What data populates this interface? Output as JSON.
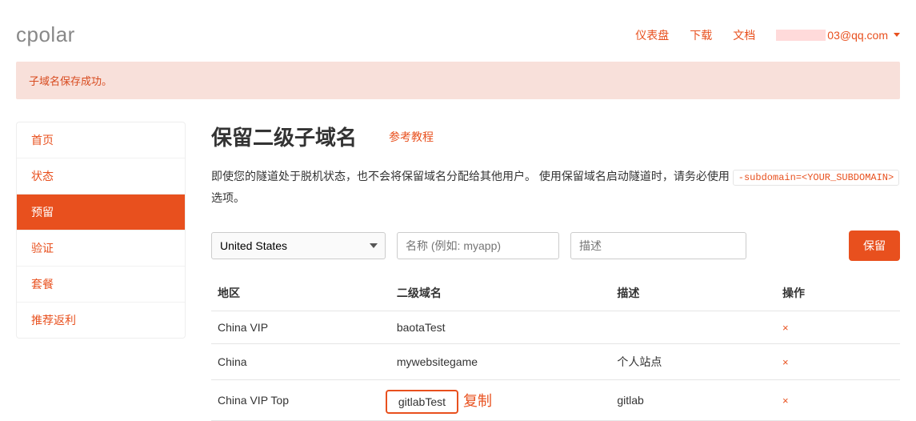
{
  "brand": "cpolar",
  "topnav": {
    "dashboard": "仪表盘",
    "download": "下载",
    "docs": "文档",
    "email_suffix": "03@qq.com"
  },
  "alert": "子域名保存成功。",
  "sidebar": {
    "items": [
      {
        "label": "首页"
      },
      {
        "label": "状态"
      },
      {
        "label": "预留"
      },
      {
        "label": "验证"
      },
      {
        "label": "套餐"
      },
      {
        "label": "推荐返利"
      }
    ],
    "active_index": 2
  },
  "main": {
    "title": "保留二级子域名",
    "help_link": "参考教程",
    "desc_before": "即使您的隧道处于脱机状态，也不会将保留域名分配给其他用户。 使用保留域名启动隧道时，请务必使用",
    "desc_code": "-subdomain=<YOUR_SUBDOMAIN>",
    "desc_after": "选项。",
    "form": {
      "region_selected": "United States",
      "name_placeholder": "名称 (例如: myapp)",
      "desc_placeholder": "描述",
      "save_label": "保留"
    },
    "table": {
      "headers": {
        "region": "地区",
        "subdomain": "二级域名",
        "desc": "描述",
        "action": "操作"
      },
      "rows": [
        {
          "region": "China VIP",
          "subdomain": "baotaTest",
          "desc": ""
        },
        {
          "region": "China",
          "subdomain": "mywebsitegame",
          "desc": "个人站点"
        },
        {
          "region": "China VIP Top",
          "subdomain": "gitlabTest",
          "desc": "gitlab"
        }
      ],
      "highlight_row": 2,
      "delete_glyph": "×"
    },
    "annotation": "复制"
  }
}
